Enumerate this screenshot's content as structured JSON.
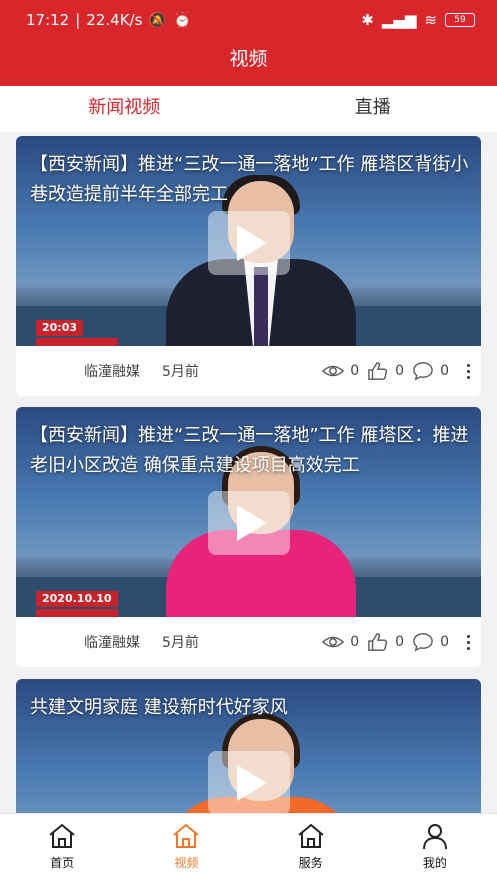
{
  "status_bar": {
    "time": "17:12",
    "speed": "22.4K/s",
    "battery": "59"
  },
  "header": {
    "title": "视频"
  },
  "tabs": [
    {
      "label": "新闻视频",
      "active": true
    },
    {
      "label": "直播",
      "active": false
    }
  ],
  "cards": [
    {
      "headline": "【西安新闻】推进“三改一通一落地”工作 雁塔区背街小巷改造提前半年全部完工",
      "tag": "20:03",
      "source": "临潼融媒",
      "time": "5月前",
      "views": "0",
      "likes": "0",
      "comments": "0"
    },
    {
      "headline": "【西安新闻】推进“三改一通一落地”工作 雁塔区：推进老旧小区改造 确保重点建设项目高效完工",
      "tag": "2020.10.10",
      "source": "临潼融媒",
      "time": "5月前",
      "views": "0",
      "likes": "0",
      "comments": "0"
    },
    {
      "headline": "共建文明家庭 建设新时代好家风"
    }
  ],
  "nav": [
    {
      "label": "首页",
      "icon": "home-icon",
      "active": false
    },
    {
      "label": "视频",
      "icon": "home-icon",
      "active": true
    },
    {
      "label": "服务",
      "icon": "home-icon",
      "active": false
    },
    {
      "label": "我的",
      "icon": "user-icon",
      "active": false
    }
  ],
  "colors": {
    "brand_red": "#d9262b",
    "nav_active": "#f07a2a"
  }
}
